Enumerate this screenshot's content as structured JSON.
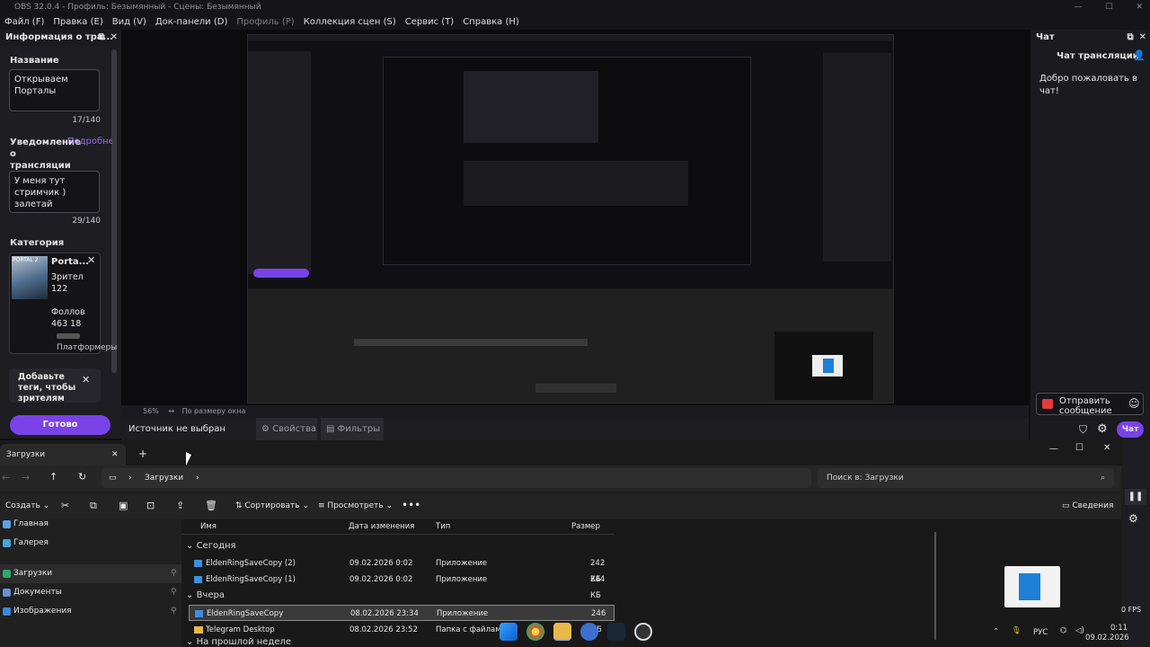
{
  "obs": {
    "title": "OBS 32.0.4 - Профиль: Безымянный - Сцены: Безымянный",
    "menu": [
      "Файл (F)",
      "Правка (E)",
      "Вид (V)",
      "Док-панели (D)",
      "Профиль (P)",
      "Коллекция сцен (S)",
      "Сервис (T)",
      "Справка (H)"
    ],
    "info_dock": {
      "title": "Информация о тра...",
      "name_label": "Название",
      "name_value": "Открываем Порталы",
      "name_count": "17/140",
      "notify_label": "Уведомление о трансляции",
      "notify_link": "Подробнее",
      "notify_value": "У меня тут стримчик ) залетай",
      "notify_count": "29/140",
      "category_label": "Категория",
      "category_name": "Porta...",
      "category_viewers_label": "Зрител",
      "category_viewers": "122",
      "category_followers_label": "Фоллов",
      "category_followers": "463 18",
      "category_thumb_text": "PORTAL 2",
      "platforms_link": "Платформеры",
      "tags_hint": "Добавьте теги, чтобы зрителям",
      "done_button": "Готово"
    },
    "status": {
      "zoom": "56%",
      "fit": "По размеру окна"
    },
    "controls": {
      "source": "Источник не выбран",
      "properties": "Свойства",
      "filters": "Фильтры"
    },
    "chat_dock": {
      "title": "Чат",
      "heading": "Чат трансляции",
      "welcome": "Добро пожаловать в чат!",
      "send_label": "Отправить сообщение",
      "chat_button": "Чат"
    }
  },
  "explorer": {
    "tab_title": "Загрузки",
    "breadcrumb": "Загрузки",
    "search_placeholder": "Поиск в: Загрузки",
    "toolbar": {
      "create": "Создать",
      "sort": "Сортировать",
      "view": "Просмотреть",
      "details": "Сведения"
    },
    "sidebar": [
      {
        "label": "Главная",
        "color": "#5aa0e8"
      },
      {
        "label": "Галерея",
        "color": "#4aa3d8"
      },
      {
        "label": "Загрузки",
        "color": "#2ea86a"
      },
      {
        "label": "Документы",
        "color": "#6a8fd8"
      },
      {
        "label": "Изображения",
        "color": "#3c88d8"
      }
    ],
    "columns": [
      "Имя",
      "Дата изменения",
      "Тип",
      "Размер"
    ],
    "groups": {
      "today": "Сегодня",
      "yesterday": "Вчера",
      "last_week": "На прошлой неделе"
    },
    "files": [
      {
        "name": "EldenRingSaveCopy (2)",
        "date": "09.02.2026 0:02",
        "type": "Приложение",
        "size": "242 КБ"
      },
      {
        "name": "EldenRingSaveCopy (1)",
        "date": "09.02.2026 0:02",
        "type": "Приложение",
        "size": "244 КБ"
      },
      {
        "name": "EldenRingSaveCopy",
        "date": "08.02.2026 23:34",
        "type": "Приложение",
        "size": "246 КБ"
      },
      {
        "name": "Telegram Desktop",
        "date": "08.02.2026 23:52",
        "type": "Папка с файлами",
        "size": ""
      }
    ]
  },
  "taskbar": {
    "lang": "РУС",
    "time": "0:11",
    "date": "09.02.2026",
    "fps": "0 FPS"
  },
  "colors": {
    "accent": "#7b42e8",
    "bg": "#0f0f12"
  }
}
